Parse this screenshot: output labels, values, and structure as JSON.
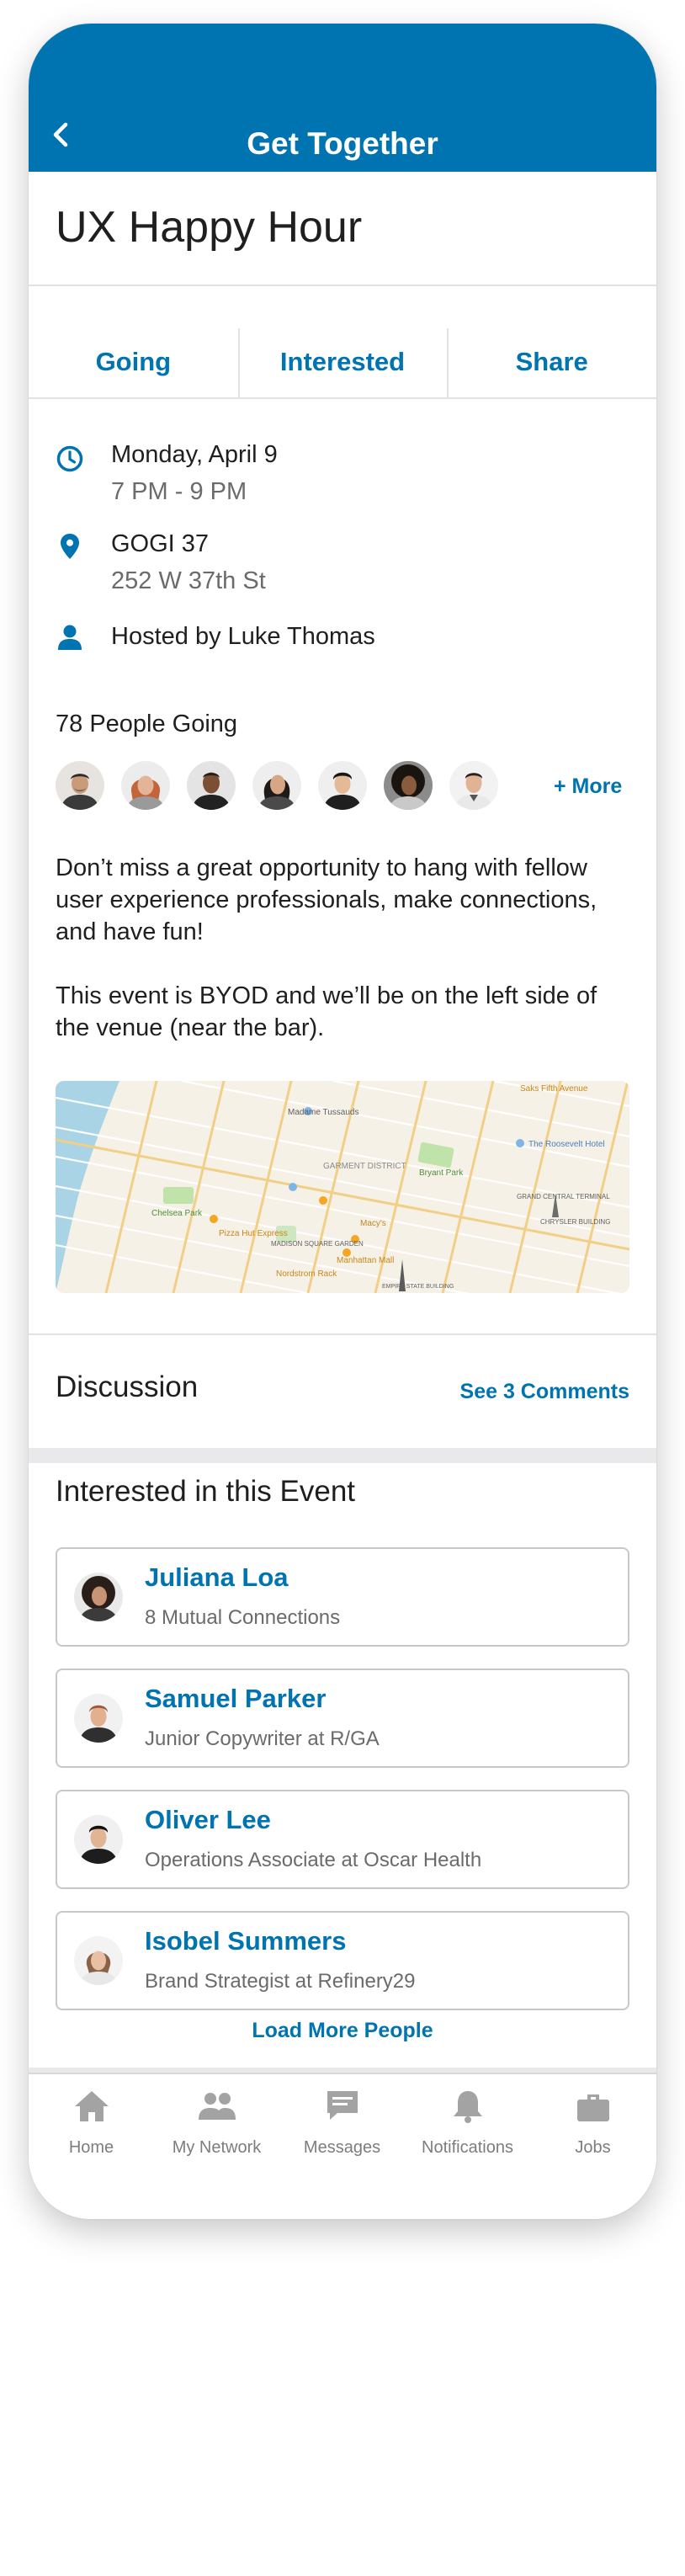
{
  "header": {
    "title": "Get Together",
    "back_icon": "chevron-left-icon"
  },
  "event": {
    "title": "UX Happy Hour",
    "actions": [
      "Going",
      "Interested",
      "Share"
    ],
    "date": "Monday, April 9",
    "time": "7 PM - 9 PM",
    "venue": "GOGI 37",
    "address": "252 W 37th St",
    "host": "Hosted by Luke Thomas",
    "going_count": "78 People Going",
    "more_label": "+ More",
    "description_1": "Don’t miss a great opportunity to hang with fellow user experience professionals, make connections, and have fun!",
    "description_2": "This event is BYOD and we’ll be on the left side of the venue (near the bar)."
  },
  "map": {
    "labels": [
      "Saks Fifth Avenue",
      "Madame Tussauds",
      "GARMENT DISTRICT",
      "Bryant Park",
      "The Roosevelt Hotel",
      "GRAND CENTRAL TERMINAL",
      "CHRYSLER BUILDING",
      "Chelsea Park",
      "Macy's",
      "MADISON SQUARE GARDEN",
      "Manhattan Mall",
      "Nordstrom Rack",
      "EMPIRE STATE BUILDING",
      "Pizza Hut Express"
    ]
  },
  "discussion": {
    "title": "Discussion",
    "link": "See 3 Comments"
  },
  "interested": {
    "title": "Interested in this Event",
    "people": [
      {
        "name": "Juliana Loa",
        "subtitle": "8 Mutual Connections"
      },
      {
        "name": "Samuel Parker",
        "subtitle": "Junior Copywriter at R/GA"
      },
      {
        "name": "Oliver Lee",
        "subtitle": "Operations Associate at Oscar Health"
      },
      {
        "name": "Isobel Summers",
        "subtitle": "Brand Strategist at Refinery29"
      }
    ],
    "load_more": "Load More People"
  },
  "tabs": [
    {
      "label": "Home",
      "icon": "home-icon"
    },
    {
      "label": "My Network",
      "icon": "people-icon"
    },
    {
      "label": "Messages",
      "icon": "message-icon"
    },
    {
      "label": "Notifications",
      "icon": "bell-icon"
    },
    {
      "label": "Jobs",
      "icon": "briefcase-icon"
    }
  ],
  "colors": {
    "brand": "#0073b1",
    "text": "#1f1f1f",
    "muted": "#6b6b6b",
    "divider": "#e2e2e2"
  }
}
